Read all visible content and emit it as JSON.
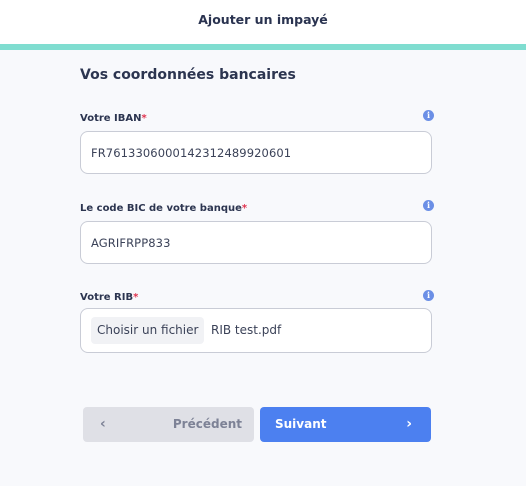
{
  "header": {
    "title": "Ajouter un impayé",
    "accent_color": "#7fddd0"
  },
  "section": {
    "title": "Vos coordonnées bancaires"
  },
  "fields": {
    "iban": {
      "label": "Votre IBAN",
      "required_mark": "*",
      "value": "FR7613306000142312489920601",
      "info_icon": "info-icon"
    },
    "bic": {
      "label": "Le code BIC de votre banque",
      "required_mark": "*",
      "value": "AGRIFRPP833",
      "info_icon": "info-icon"
    },
    "rib": {
      "label": "Votre RIB",
      "required_mark": "*",
      "button_label": "Choisir un fichier",
      "file_name": "RIB test.pdf",
      "info_icon": "info-icon"
    }
  },
  "buttons": {
    "previous": {
      "label": "Précédent",
      "icon": "chevron-left-icon"
    },
    "next": {
      "label": "Suivant",
      "icon": "chevron-right-icon",
      "color": "#4c80f0"
    }
  }
}
